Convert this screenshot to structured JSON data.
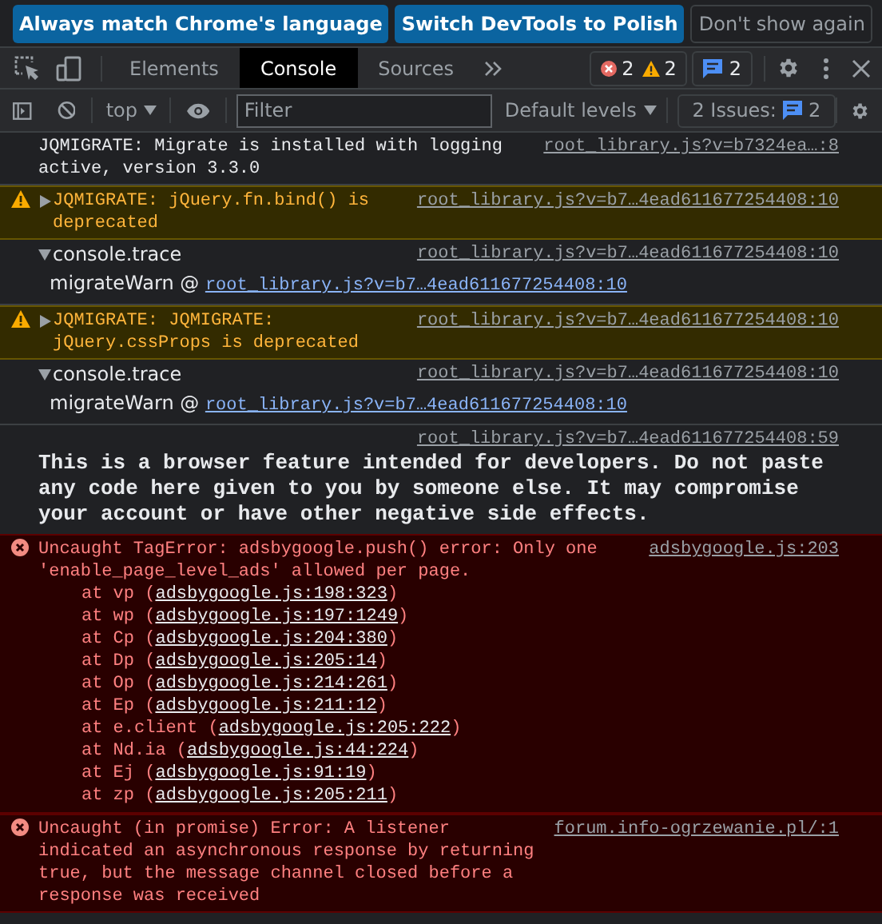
{
  "language_bar": {
    "buttons": [
      {
        "label": "Always match Chrome's language",
        "kind": "primary"
      },
      {
        "label": "Switch DevTools to Polish",
        "kind": "primary"
      },
      {
        "label": "Don't show again",
        "kind": "secondary"
      }
    ]
  },
  "tabs": [
    {
      "label": "Elements",
      "selected": false
    },
    {
      "label": "Console",
      "selected": true
    },
    {
      "label": "Sources",
      "selected": false
    }
  ],
  "counters": {
    "errors": "2",
    "warnings": "2",
    "messages": "2"
  },
  "toolbar": {
    "context": "top",
    "filter": {
      "placeholder": "Filter"
    },
    "levels": "Default levels",
    "issues": {
      "label": "2 Issues:",
      "count": "2"
    }
  },
  "messages": [
    {
      "kind": "log",
      "text": "JQMIGRATE: Migrate is installed with logging active, version 3.3.0",
      "source": "root_library.js?v=b7324ea…:8"
    },
    {
      "kind": "warning",
      "expanded": false,
      "text": "JQMIGRATE: jQuery.fn.bind() is deprecated",
      "source": "root_library.js?v=b7…4ead611677254408:10"
    },
    {
      "kind": "trace",
      "expanded": true,
      "text": "console.trace",
      "source": "root_library.js?v=b7…4ead611677254408:10",
      "frames": [
        {
          "before": "migrateWarn @ ",
          "location": "root_library.js?v=b7…4ead611677254408:10"
        }
      ]
    },
    {
      "kind": "warning",
      "expanded": false,
      "text": "JQMIGRATE: JQMIGRATE: jQuery.cssProps is deprecated",
      "source": "root_library.js?v=b7…4ead611677254408:10"
    },
    {
      "kind": "trace",
      "expanded": true,
      "text": "console.trace",
      "source": "root_library.js?v=b7…4ead611677254408:10",
      "frames": [
        {
          "before": "migrateWarn @ ",
          "location": "root_library.js?v=b7…4ead611677254408:10"
        }
      ]
    },
    {
      "kind": "info",
      "text": "This is a browser feature intended for developers. Do not paste any code here given to you by someone else. It may compromise your account or have other negative side effects.",
      "source": "root_library.js?v=b7…4ead611677254408:59"
    },
    {
      "kind": "error",
      "text": "Uncaught TagError: adsbygoogle.push() error: Only one 'enable_page_level_ads' allowed per page.",
      "source": "adsbygoogle.js:203",
      "frames": [
        {
          "before": "at vp (",
          "location": "adsbygoogle.js:198:323",
          "after": ")"
        },
        {
          "before": "at wp (",
          "location": "adsbygoogle.js:197:1249",
          "after": ")"
        },
        {
          "before": "at Cp (",
          "location": "adsbygoogle.js:204:380",
          "after": ")"
        },
        {
          "before": "at Dp (",
          "location": "adsbygoogle.js:205:14",
          "after": ")"
        },
        {
          "before": "at Op (",
          "location": "adsbygoogle.js:214:261",
          "after": ")"
        },
        {
          "before": "at Ep (",
          "location": "adsbygoogle.js:211:12",
          "after": ")"
        },
        {
          "before": "at e.client (",
          "location": "adsbygoogle.js:205:222",
          "after": ")"
        },
        {
          "before": "at Nd.ia (",
          "location": "adsbygoogle.js:44:224",
          "after": ")"
        },
        {
          "before": "at Ej (",
          "location": "adsbygoogle.js:91:19",
          "after": ")"
        },
        {
          "before": "at zp (",
          "location": "adsbygoogle.js:205:211",
          "after": ")"
        }
      ]
    },
    {
      "kind": "error",
      "text": "Uncaught (in promise) Error: A listener indicated an asynchronous response by returning true, but the message channel closed before a response was received",
      "source": "forum.info-ogrzewanie.pl/:1"
    }
  ]
}
